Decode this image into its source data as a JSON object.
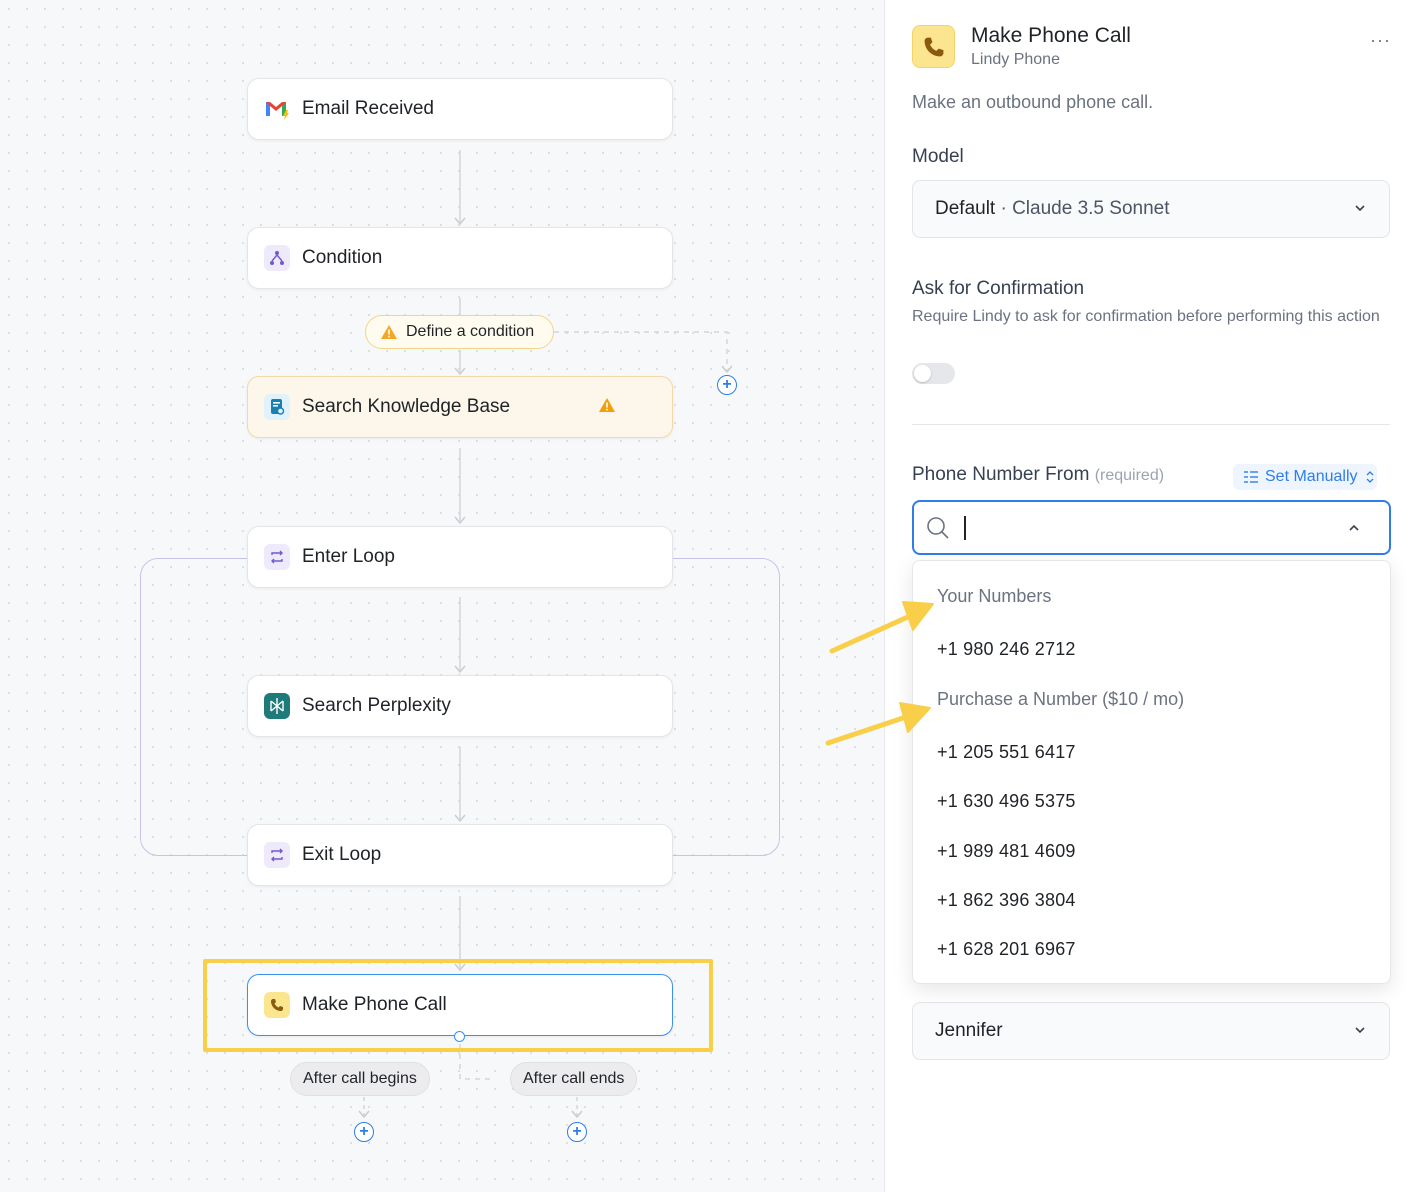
{
  "canvas": {
    "nodes": {
      "email_received": "Email Received",
      "condition": "Condition",
      "search_kb": "Search Knowledge Base",
      "enter_loop": "Enter Loop",
      "search_perplexity": "Search Perplexity",
      "exit_loop": "Exit Loop",
      "make_phone_call": "Make Phone Call"
    },
    "condition_pill": "Define a condition",
    "branches": {
      "after_call_begins": "After call begins",
      "after_call_ends": "After call ends"
    }
  },
  "panel": {
    "title": "Make Phone Call",
    "subtitle": "Lindy Phone",
    "more": "···",
    "description": "Make an outbound phone call.",
    "model": {
      "label": "Model",
      "value_bold": "Default",
      "value_rest": " · Claude 3.5 Sonnet"
    },
    "confirmation": {
      "label": "Ask for Confirmation",
      "helper": "Require Lindy to ask for confirmation before performing this action",
      "enabled": false
    },
    "phone_from": {
      "label": "Phone Number From",
      "required": "(required)",
      "set_manually": "Set Manually",
      "search_value": ""
    },
    "dropdown": {
      "group_your_numbers": "Your Numbers",
      "your_numbers": [
        "+1 980 246 2712"
      ],
      "group_purchase": "Purchase a Number ($10 / mo)",
      "purchase_numbers": [
        "+1 205 551 6417",
        "+1 630 496 5375",
        "+1 989 481 4609",
        "+1 862 396 3804",
        "+1 628 201 6967"
      ]
    },
    "voice": {
      "value": "Jennifer"
    }
  },
  "colors": {
    "accent_blue": "#2f7de8",
    "highlight_yellow": "#f9cf4a",
    "warning_orange": "#f59e0b",
    "loop_purple": "#c8c3ea"
  }
}
